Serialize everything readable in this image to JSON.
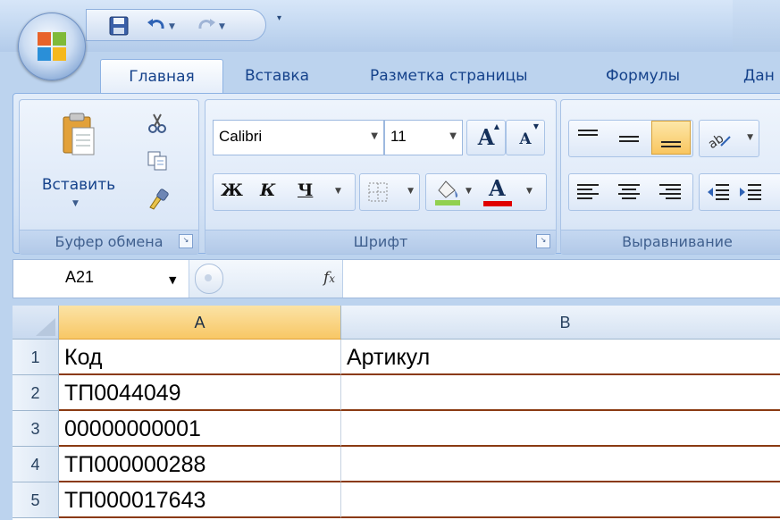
{
  "qat": {
    "icons": [
      "save-icon",
      "undo-icon",
      "redo-icon",
      "customize-qat-icon"
    ]
  },
  "tabs": [
    {
      "label": "Главная",
      "active": true
    },
    {
      "label": "Вставка",
      "active": false
    },
    {
      "label": "Разметка страницы",
      "active": false
    },
    {
      "label": "Формулы",
      "active": false
    },
    {
      "label": "Дан",
      "active": false
    }
  ],
  "ribbon": {
    "clipboard": {
      "label": "Буфер обмена",
      "paste_label": "Вставить"
    },
    "font": {
      "label": "Шрифт",
      "font_name": "Calibri",
      "font_size": "11",
      "bold": "Ж",
      "italic": "К",
      "underline": "Ч",
      "grow": "A",
      "shrink": "A",
      "font_color_glyph": "A",
      "fill_color": "#92d050",
      "font_color": "#e00000"
    },
    "alignment": {
      "label": "Выравнивание"
    }
  },
  "formula_bar": {
    "name_box": "A21",
    "fx": "fx",
    "value": ""
  },
  "sheet": {
    "columns": [
      "A",
      "B"
    ],
    "selected_column": "A",
    "rows": [
      {
        "num": "1",
        "cells": [
          "Код",
          "Артикул"
        ]
      },
      {
        "num": "2",
        "cells": [
          "ТП0044049",
          ""
        ]
      },
      {
        "num": "3",
        "cells": [
          "00000000001",
          ""
        ]
      },
      {
        "num": "4",
        "cells": [
          "ТП000000288",
          ""
        ]
      },
      {
        "num": "5",
        "cells": [
          "ТП000017643",
          ""
        ]
      }
    ]
  }
}
